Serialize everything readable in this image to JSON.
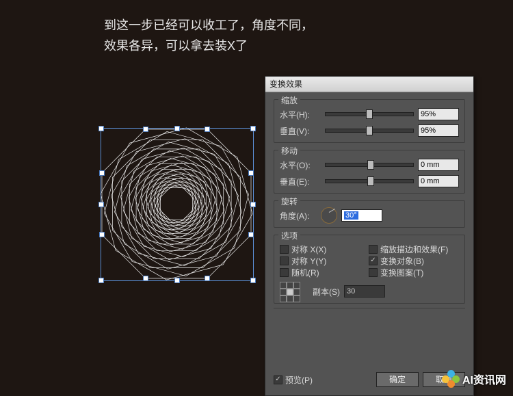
{
  "caption": {
    "line1": "到这一步已经可以收工了，角度不同，",
    "line2": "效果各异，可以拿去装X了"
  },
  "dialog": {
    "title": "变换效果",
    "scale": {
      "legend": "缩放",
      "h_label": "水平(H):",
      "h_value": "95%",
      "v_label": "垂直(V):",
      "v_value": "95%"
    },
    "move": {
      "legend": "移动",
      "h_label": "水平(O):",
      "h_value": "0 mm",
      "v_label": "垂直(E):",
      "v_value": "0 mm"
    },
    "rotate": {
      "legend": "旋转",
      "angle_label": "角度(A):",
      "angle_value": "30°"
    },
    "options": {
      "legend": "选项",
      "reflect_x": "对称 X(X)",
      "reflect_y": "对称 Y(Y)",
      "random": "随机(R)",
      "scale_strokes": "缩放描边和效果(F)",
      "transform_objects": "变换对象(B)",
      "transform_patterns": "变换图案(T)",
      "transform_objects_checked": true
    },
    "copies_label": "副本(S)",
    "copies_value": "30",
    "preview_label": "预览(P)",
    "preview_checked": true,
    "ok": "确定",
    "cancel": "取消"
  },
  "watermark": "AI资讯网"
}
